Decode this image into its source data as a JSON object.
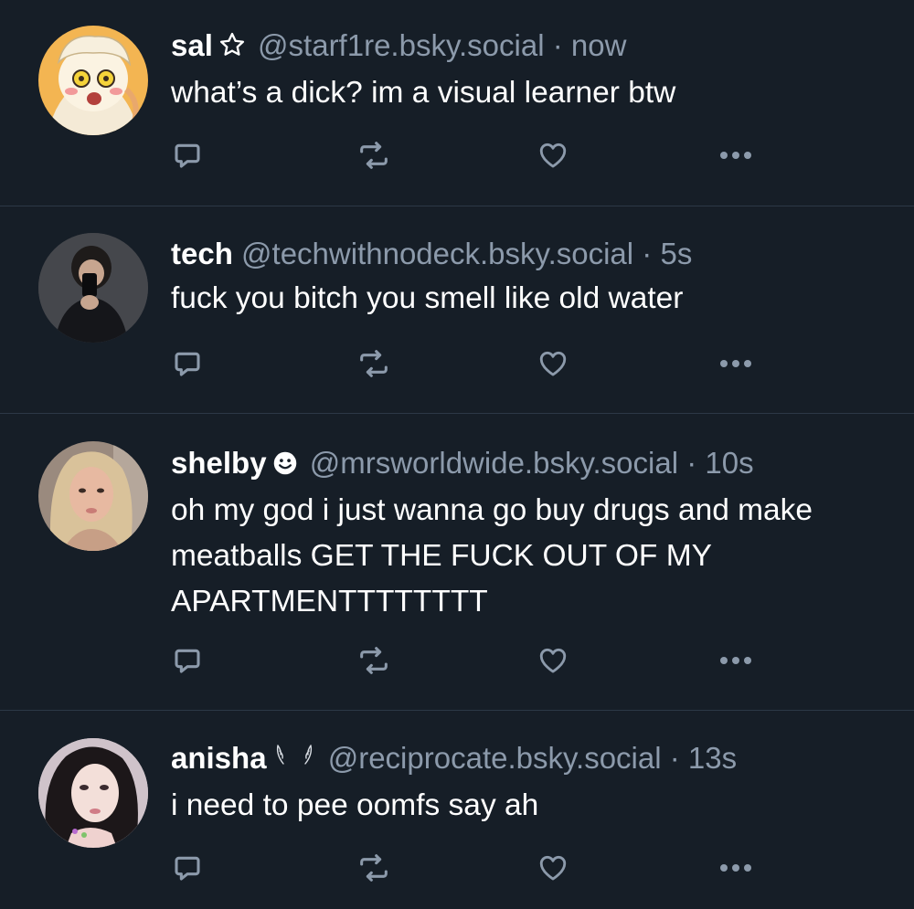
{
  "icons": {
    "reply": "reply-icon",
    "repost": "repost-icon",
    "like": "heart-icon",
    "more": "more-icon"
  },
  "colors": {
    "background": "#161e27",
    "divider": "#2c3846",
    "secondary_text": "#8c9aab",
    "action_icon": "#8c9aab"
  },
  "posts": [
    {
      "display_name": "sal",
      "name_icon": "star-outline-icon",
      "handle": "@starf1re.bsky.social",
      "separator": "·",
      "time": "now",
      "text": "what’s a dick? im a visual learner btw"
    },
    {
      "display_name": "tech",
      "name_icon": "",
      "handle": "@techwithnodeck.bsky.social",
      "separator": "·",
      "time": "5s",
      "text": "fuck you bitch you smell like old water"
    },
    {
      "display_name": "shelby",
      "name_icon": "smiley-icon",
      "handle": "@mrsworldwide.bsky.social",
      "separator": "·",
      "time": "10s",
      "text": "oh my god i just wanna go buy drugs and make meatballs GET THE FUCK OUT OF MY APARTMENTTTTTTTT"
    },
    {
      "display_name": "anisha",
      "name_icon": "feather-wings-icon",
      "handle": "@reciprocate.bsky.social",
      "separator": "·",
      "time": "13s",
      "text": "i need to pee oomfs say ah"
    }
  ]
}
